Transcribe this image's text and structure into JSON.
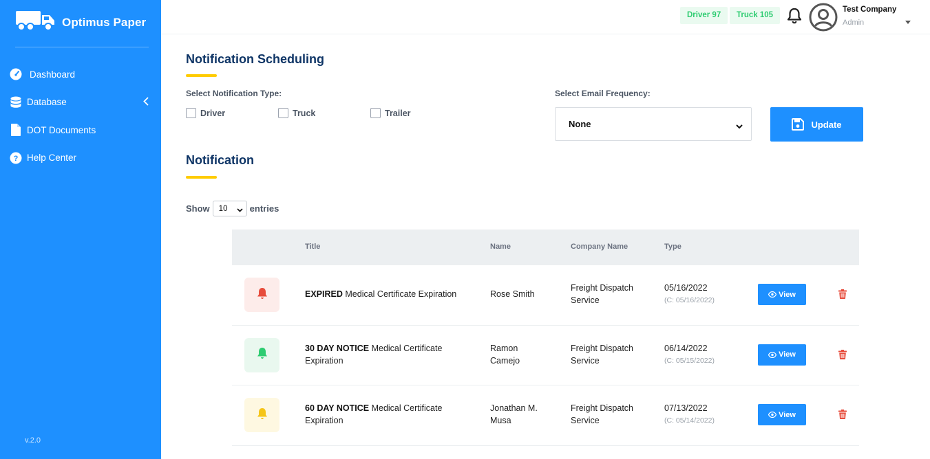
{
  "brand": {
    "name": "Optimus Paper",
    "version": "v.2.0"
  },
  "sidebar": {
    "items": [
      {
        "label": "Dashboard",
        "icon": "dashboard-gauge-icon"
      },
      {
        "label": "Database",
        "icon": "database-icon"
      },
      {
        "label": "DOT Documents",
        "icon": "document-icon"
      },
      {
        "label": "Help Center",
        "icon": "help-circle-icon"
      }
    ]
  },
  "header": {
    "driver_pill": "Driver 97",
    "truck_pill": "Truck 105",
    "user_name": "Test Company",
    "user_role": "Admin"
  },
  "scheduling": {
    "title": "Notification Scheduling",
    "type_label": "Select Notification Type:",
    "types": [
      "Driver",
      "Truck",
      "Trailer"
    ],
    "frequency_label": "Select Email Frequency:",
    "frequency_value": "None",
    "update_label": "Update"
  },
  "notifications": {
    "title": "Notification",
    "show_label": "Show",
    "entries_value": "10",
    "entries_label": "entries",
    "columns": [
      "Title",
      "Name",
      "Company Name",
      "Type"
    ],
    "view_label": "View",
    "rows": [
      {
        "status": "EXPIRED",
        "title": "Medical Certificate Expiration",
        "name": "Rose Smith",
        "company": "Freight Dispatch Service",
        "date": "05/16/2022",
        "created": "(C: 05/16/2022)",
        "color": "#e74c3c",
        "bg": "#fdecea"
      },
      {
        "status": "30 DAY NOTICE",
        "title": "Medical Certificate Expiration",
        "name": "Ramon Camejo",
        "company": "Freight Dispatch Service",
        "date": "06/14/2022",
        "created": "(C: 05/15/2022)",
        "color": "#2ecc71",
        "bg": "#e9f8ef"
      },
      {
        "status": "60 DAY NOTICE",
        "title": "Medical Certificate Expiration",
        "name": "Jonathan M. Musa",
        "company": "Freight Dispatch Service",
        "date": "07/13/2022",
        "created": "(C: 05/14/2022)",
        "color": "#f5c518",
        "bg": "#fef8e1"
      }
    ]
  },
  "colors": {
    "accent": "#1e90ff",
    "heading": "#0f3566",
    "underline": "#ffcc00",
    "pill_text": "#2ecc71",
    "trash": "#e74c3c"
  }
}
